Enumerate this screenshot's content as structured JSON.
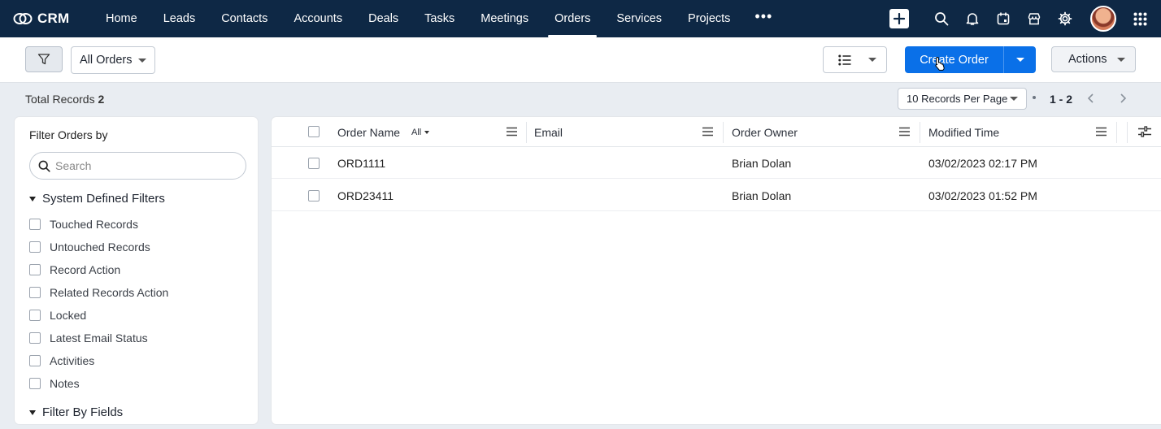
{
  "nav": {
    "brand": "CRM",
    "items": [
      "Home",
      "Leads",
      "Contacts",
      "Accounts",
      "Deals",
      "Tasks",
      "Meetings",
      "Orders",
      "Services",
      "Projects"
    ],
    "active": "Orders",
    "more": "•••",
    "right_icons": [
      "plus-icon",
      "search-icon",
      "bell-icon",
      "calendar-icon",
      "marketplace-icon",
      "gear-icon",
      "avatar",
      "app-grid-icon"
    ]
  },
  "toolbar": {
    "view_name": "All Orders",
    "create_label": "Create Order",
    "actions_label": "Actions"
  },
  "records": {
    "total_label": "Total Records",
    "total_count": "2",
    "per_page": "10 Records Per Page",
    "range": "1 - 2"
  },
  "sidebar": {
    "title": "Filter Orders by",
    "search_placeholder": "Search",
    "system_section": "System Defined Filters",
    "system_filters": [
      "Touched Records",
      "Untouched Records",
      "Record Action",
      "Related Records Action",
      "Locked",
      "Latest Email Status",
      "Activities",
      "Notes"
    ],
    "fields_section": "Filter By Fields"
  },
  "table": {
    "columns": {
      "order_name": "Order Name",
      "order_name_filter": "All",
      "email": "Email",
      "owner": "Order Owner",
      "modified": "Modified Time"
    },
    "rows": [
      {
        "order_name": "ORD1111",
        "email": "",
        "owner": "Brian Dolan",
        "modified": "03/02/2023 02:17 PM"
      },
      {
        "order_name": "ORD23411",
        "email": "",
        "owner": "Brian Dolan",
        "modified": "03/02/2023 01:52 PM"
      }
    ]
  },
  "colors": {
    "nav_bg": "#0e2845",
    "primary": "#0a70e8",
    "page_bg": "#e9edf2"
  }
}
